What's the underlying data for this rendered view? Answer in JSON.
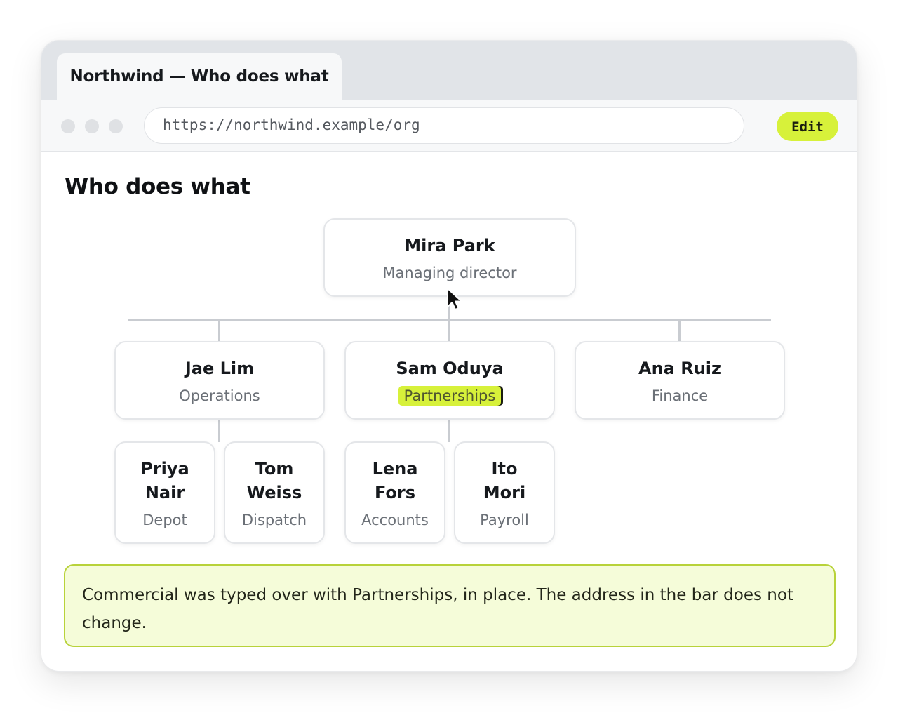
{
  "browser": {
    "tab_title": "Northwind — Who does what",
    "url": "https://northwind.example/org",
    "edit_label": "Edit"
  },
  "page": {
    "title": "Who does what"
  },
  "org": {
    "root": {
      "name": "Mira Park",
      "role": "Managing director"
    },
    "level1": [
      {
        "name": "Jae Lim",
        "role": "Operations"
      },
      {
        "name": "Sam Oduya",
        "role": "Partnerships"
      },
      {
        "name": "Ana Ruiz",
        "role": "Finance"
      }
    ],
    "level2": [
      {
        "first": "Priya",
        "last": "Nair",
        "role": "Depot"
      },
      {
        "first": "Tom",
        "last": "Weiss",
        "role": "Dispatch"
      },
      {
        "first": "Lena",
        "last": "Fors",
        "role": "Accounts"
      },
      {
        "first": "Ito",
        "last": "Mori",
        "role": "Payroll"
      }
    ]
  },
  "note": {
    "text": "Commercial was typed over with Partnerships, in place. The address in the bar does not change."
  },
  "colors": {
    "accent": "#d7f13a",
    "note_bg": "#f5fcd9",
    "note_border": "#b8d23a"
  }
}
